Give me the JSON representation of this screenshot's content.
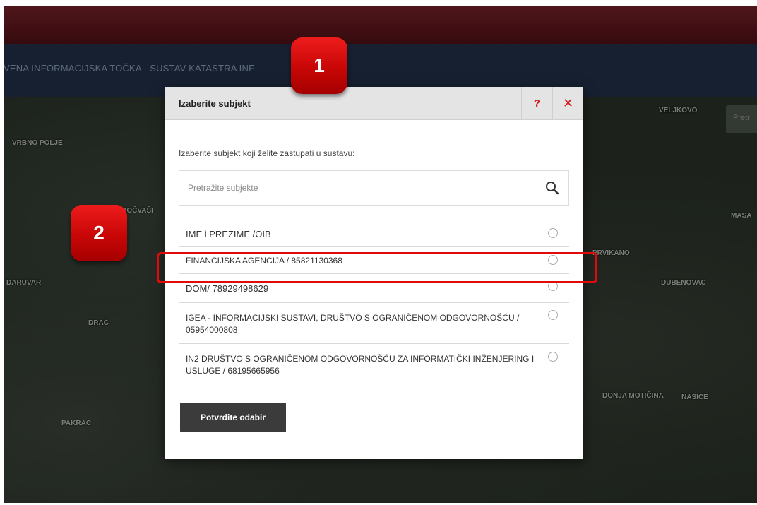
{
  "header": {
    "title": "VENA INFORMACIJSKA TOČKA - SUSTAV KATASTRA INF"
  },
  "map": {
    "labels": [
      "VRBNO POLJE",
      "DARUVAR",
      "DRAČ",
      "PAKRAC",
      "MASA",
      "PRVIKANO",
      "DUBENOVAC",
      "DONJA MOTIČINA",
      "NAŠICE",
      "VELJKOVO",
      "MOČVAŠI"
    ],
    "right_chip": "Pretr"
  },
  "modal": {
    "title": "Izaberite subjekt",
    "help_icon": "?",
    "close_icon": "✕",
    "instruction": "Izaberite subjekt koji želite zastupati u sustavu:",
    "search": {
      "placeholder": "Pretražite subjekte"
    },
    "subjects": [
      "IME i PREZIME /OIB",
      "FINANCIJSKA AGENCIJA / 85821130368",
      "DOM/ 78929498629",
      "IGEA - INFORMACIJSKI SUSTAVI, DRUŠTVO S OGRANIČENOM ODGOVORNOŠĆU / 05954000808",
      "IN2 DRUŠTVO S OGRANIČENOM ODGOVORNOŠĆU ZA INFORMATIČKI INŽENJERING I USLUGE / 68195665956"
    ],
    "confirm_label": "Potvrdite odabir"
  },
  "callouts": {
    "one": "1",
    "two": "2"
  },
  "colors": {
    "callout_red": "#d80b0b",
    "highlight_red": "#e00a0a",
    "header_bg": "#e4e4e4",
    "confirm_bg": "#3b3b3b",
    "top_bar": "#4a1216",
    "title_bar": "#1a2538"
  }
}
